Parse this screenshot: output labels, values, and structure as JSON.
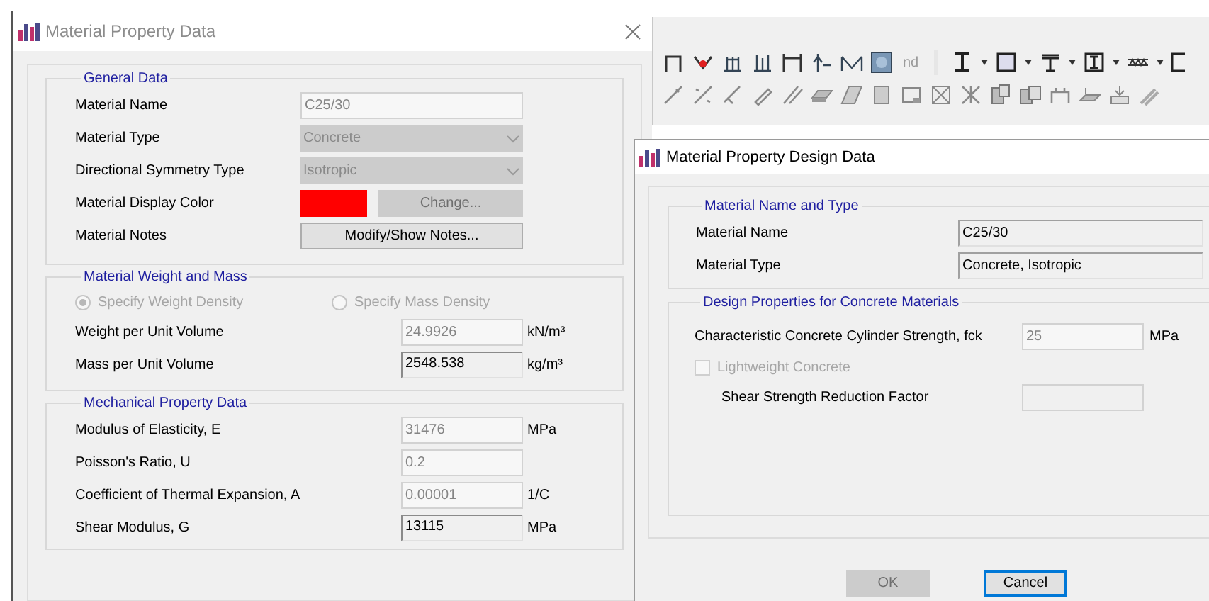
{
  "toolbar": {
    "label": "nd"
  },
  "main_dialog": {
    "title": "Material Property Data",
    "general": {
      "title": "General Data",
      "rows": [
        {
          "kind": "field",
          "label": "Material Name",
          "value": "C25/30",
          "disabled": true
        },
        {
          "kind": "dropdown",
          "label": "Material Type",
          "value": "Concrete",
          "disabled": true
        },
        {
          "kind": "dropdown",
          "label": "Directional Symmetry Type",
          "value": "Isotropic",
          "disabled": true
        },
        {
          "kind": "color",
          "label": "Material Display Color",
          "color": "#ff0000",
          "button": "Change...",
          "disabled": true
        },
        {
          "kind": "button",
          "label": "Material Notes",
          "button": "Modify/Show Notes...",
          "disabled": false
        }
      ]
    },
    "weight": {
      "title": "Material Weight and Mass",
      "radios_disabled": true,
      "radios": [
        {
          "label": "Specify Weight Density",
          "selected": true
        },
        {
          "label": "Specify Mass Density",
          "selected": false
        }
      ],
      "rows": [
        {
          "label": "Weight per Unit Volume",
          "value": "24.9926",
          "unit": "kN/m³",
          "disabled": true
        },
        {
          "label": "Mass per Unit Volume",
          "value": "2548.538",
          "unit": "kg/m³",
          "disabled": false
        }
      ]
    },
    "mechanical": {
      "title": "Mechanical Property Data",
      "rows": [
        {
          "label": "Modulus of Elasticity,  E",
          "value": "31476",
          "unit": "MPa",
          "disabled": true
        },
        {
          "label": "Poisson's Ratio,  U",
          "value": "0.2",
          "disabled": true
        },
        {
          "label": "Coefficient of Thermal Expansion,  A",
          "value": "0.00001",
          "unit": "1/C",
          "disabled": true
        },
        {
          "label": "Shear Modulus,  G",
          "value": "13115",
          "unit": "MPa",
          "disabled": false
        }
      ]
    }
  },
  "design_dialog": {
    "title": "Material Property Design Data",
    "name_group": {
      "title": "Material Name and Type",
      "rows": [
        {
          "label": "Material Name",
          "value": "C25/30"
        },
        {
          "label": "Material Type",
          "value": "Concrete, Isotropic"
        }
      ]
    },
    "design_group": {
      "title": "Design Properties for Concrete Materials",
      "strength": {
        "label": "Characteristic Concrete Cylinder Strength, fck",
        "value": "25",
        "unit": "MPa",
        "disabled": true
      },
      "lightweight": {
        "label": "Lightweight Concrete",
        "checked": false,
        "disabled": true
      },
      "reduction": {
        "label": "Shear Strength Reduction Factor",
        "disabled": true
      }
    },
    "buttons": [
      {
        "label": "OK",
        "disabled": true,
        "focused": false
      },
      {
        "label": "Cancel",
        "disabled": false,
        "focused": true
      }
    ]
  }
}
